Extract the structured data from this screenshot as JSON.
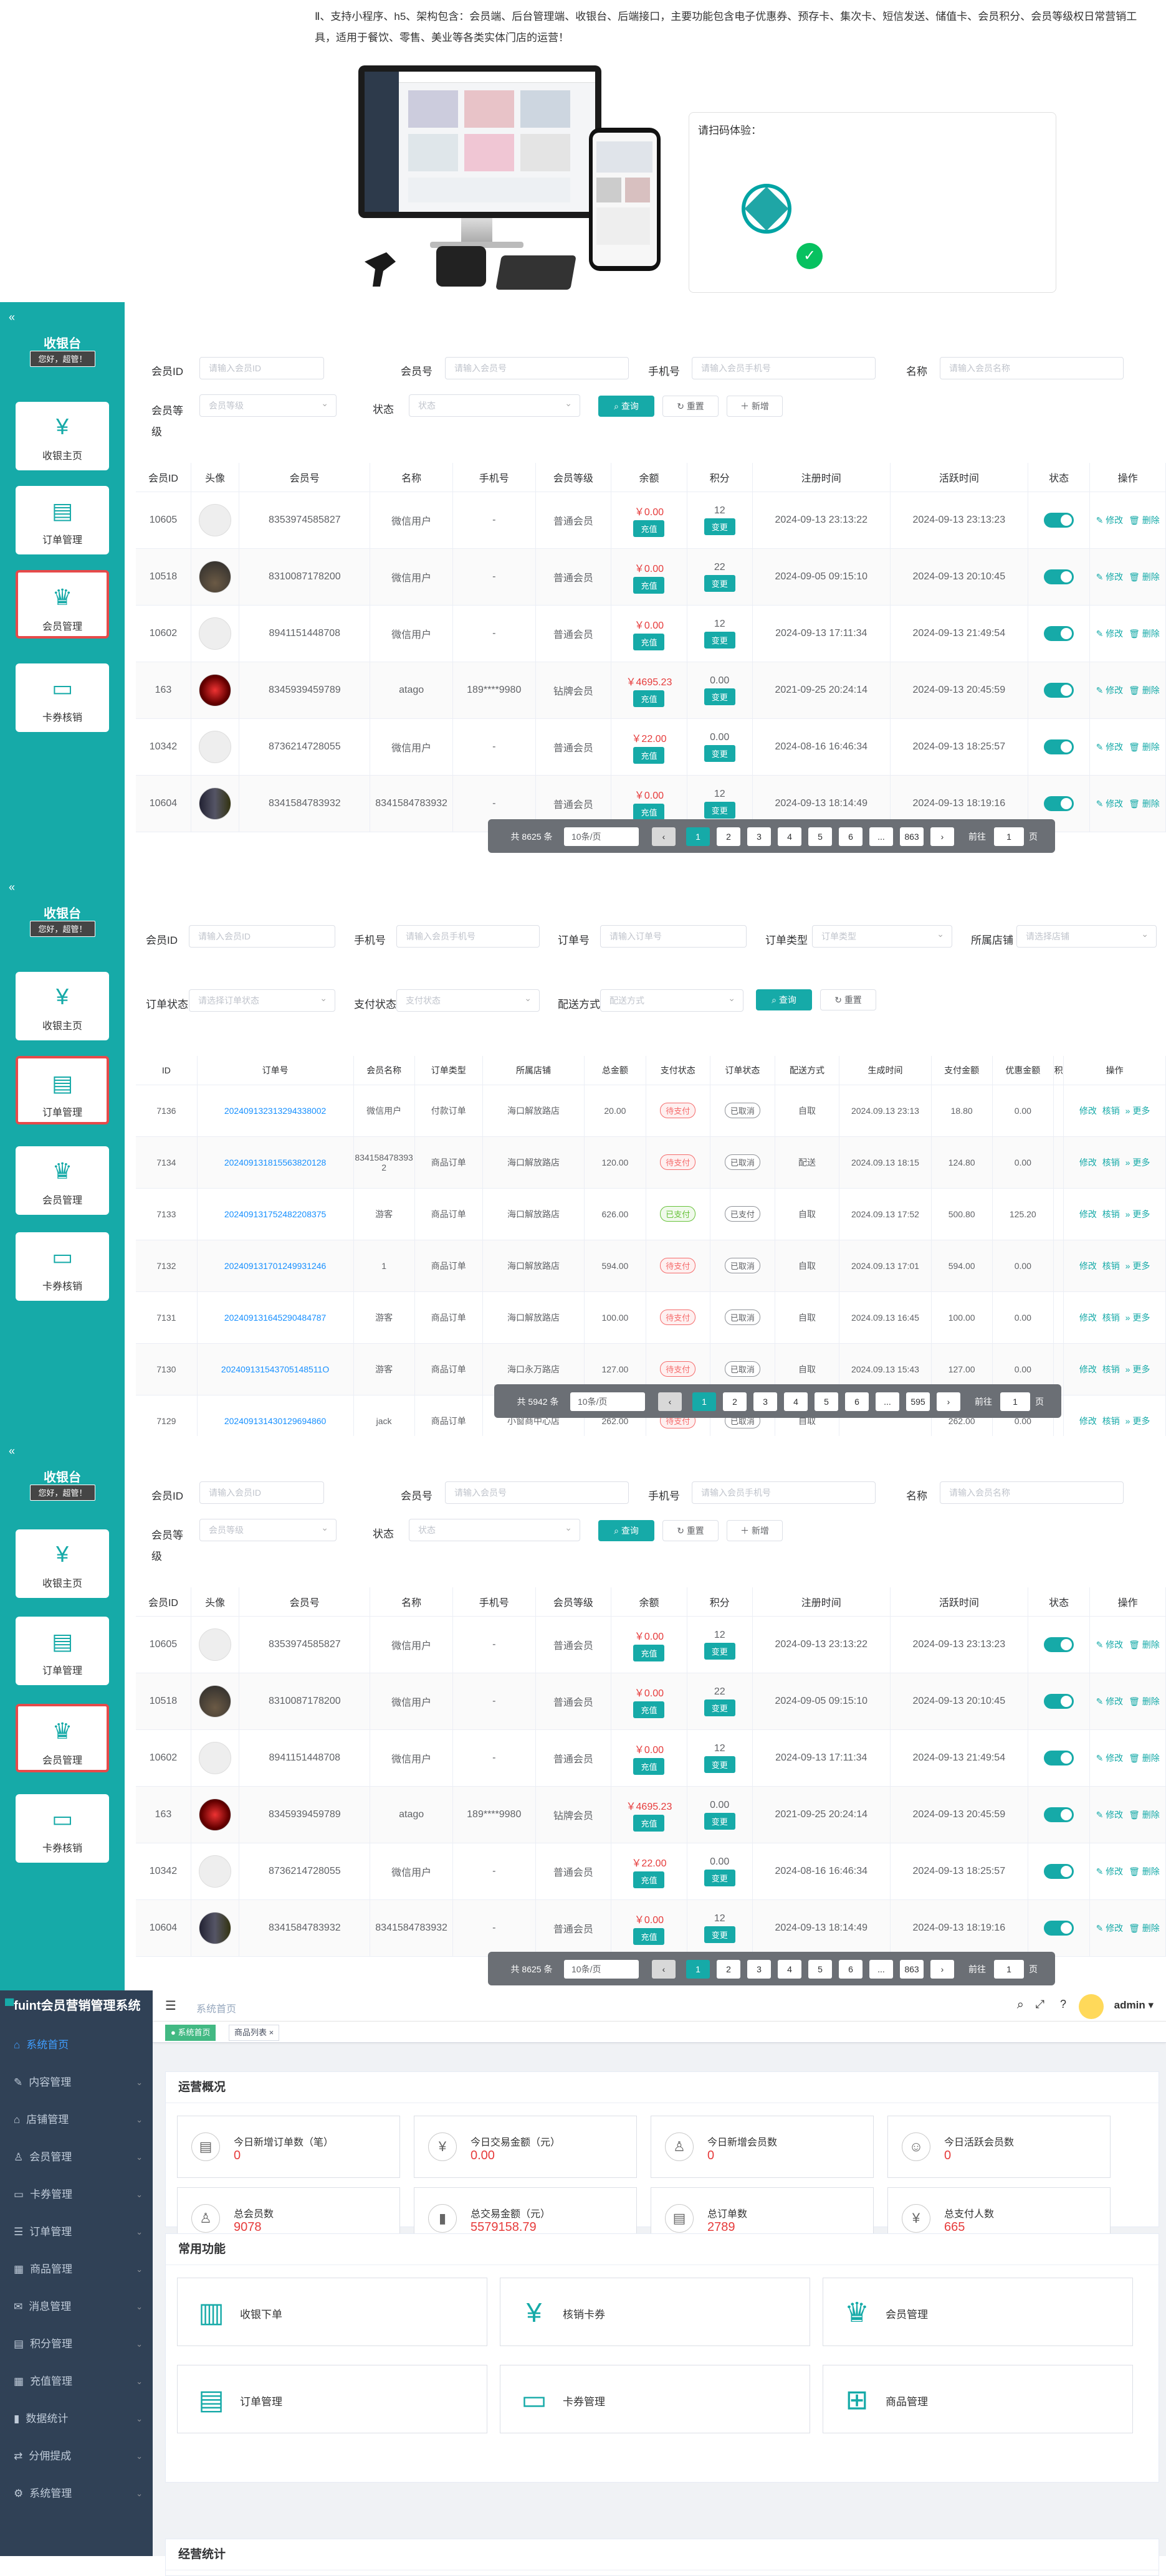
{
  "hero": {
    "text": "Ⅱ、支持小程序、h5、架构包含：会员端、后台管理端、收银台、后端接口，主要功能包含电子优惠券、预存卡、集次卡、短信发送、储值卡、会员积分、会员等级权日常营销工具，适用于餐饮、零售、美业等各类实体门店的运营！",
    "qr_label": "请扫码体验："
  },
  "cashier": {
    "title": "收银台",
    "greet": "您好，超管！",
    "nav": [
      "收银主页",
      "订单管理",
      "会员管理",
      "卡券核销"
    ]
  },
  "member_panel": {
    "filters": {
      "id_label": "会员ID",
      "id_ph": "请输入会员ID",
      "no_label": "会员号",
      "no_ph": "请输入会员号",
      "phone_label": "手机号",
      "phone_ph": "请输入会员手机号",
      "name_label": "名称",
      "name_ph": "请输入会员名称",
      "grade_label": "会员等级",
      "grade_ph": "会员等级",
      "status_label": "状态",
      "status_ph": "状态",
      "query": "查询",
      "reset": "重置",
      "add": "新增"
    },
    "columns": [
      "会员ID",
      "头像",
      "会员号",
      "名称",
      "手机号",
      "会员等级",
      "余额",
      "积分",
      "注册时间",
      "活跃时间",
      "状态",
      "操作"
    ],
    "rows": [
      {
        "id": "10605",
        "no": "8353974585827",
        "name": "微信用户",
        "phone": "-",
        "grade": "普通会员",
        "bal": "￥0.00",
        "pts": "12",
        "reg": "2024-09-13 23:13:22",
        "act": "2024-09-13 23:13:23",
        "av": "blank"
      },
      {
        "id": "10518",
        "no": "8310087178200",
        "name": "微信用户",
        "phone": "-",
        "grade": "普通会员",
        "bal": "￥0.00",
        "pts": "22",
        "reg": "2024-09-05 09:15:10",
        "act": "2024-09-13 20:10:45",
        "av": "a1"
      },
      {
        "id": "10602",
        "no": "8941151448708",
        "name": "微信用户",
        "phone": "-",
        "grade": "普通会员",
        "bal": "￥0.00",
        "pts": "12",
        "reg": "2024-09-13 17:11:34",
        "act": "2024-09-13 21:49:54",
        "av": "blank"
      },
      {
        "id": "163",
        "no": "8345939459789",
        "name": "atago",
        "phone": "189****9980",
        "grade": "钻牌会员",
        "bal": "￥4695.23",
        "pts": "0.00",
        "reg": "2021-09-25 20:24:14",
        "act": "2024-09-13 20:45:59",
        "av": "a2"
      },
      {
        "id": "10342",
        "no": "8736214728055",
        "name": "微信用户",
        "phone": "-",
        "grade": "普通会员",
        "bal": "￥22.00",
        "pts": "0.00",
        "reg": "2024-08-16 16:46:34",
        "act": "2024-09-13 18:25:57",
        "av": "blank"
      },
      {
        "id": "10604",
        "no": "8341584783932",
        "name": "8341584783932",
        "phone": "-",
        "grade": "普通会员",
        "bal": "￥0.00",
        "pts": "12",
        "reg": "2024-09-13 18:14:49",
        "act": "2024-09-13 18:19:16",
        "av": "a3"
      }
    ],
    "charge": "充值",
    "change": "变更",
    "edit": "修改",
    "del": "删除",
    "pager": {
      "total": "共 8625 条",
      "size": "10条/页",
      "pages": [
        "1",
        "2",
        "3",
        "4",
        "5",
        "6",
        "...",
        "863"
      ],
      "goto": "前往",
      "page": "1",
      "unit": "页"
    }
  },
  "order_panel": {
    "filters": {
      "mid_label": "会员ID",
      "mid_ph": "请输入会员ID",
      "phone_label": "手机号",
      "phone_ph": "请输入会员手机号",
      "ono_label": "订单号",
      "ono_ph": "请输入订单号",
      "otype_label": "订单类型",
      "otype_ph": "订单类型",
      "store_label": "所属店铺",
      "store_ph": "请选择店铺",
      "ostat_label": "订单状态",
      "ostat_ph": "请选择订单状态",
      "pay_label": "支付状态",
      "pay_ph": "支付状态",
      "del_label": "配送方式",
      "del_ph": "配送方式",
      "query": "查询",
      "reset": "重置"
    },
    "columns": [
      "ID",
      "订单号",
      "会员名称",
      "订单类型",
      "所属店铺",
      "总金额",
      "支付状态",
      "订单状态",
      "配送方式",
      "生成时间",
      "支付金额",
      "优惠金额",
      "积",
      "操作"
    ],
    "rows": [
      {
        "id": "7136",
        "no": "202409132313294338002",
        "mem": "微信用户",
        "type": "付款订单",
        "store": "海口解放路店",
        "amt": "20.00",
        "pay": "待支付",
        "ps": "w",
        "st": "已取消",
        "del": "自取",
        "time": "2024.09.13 23:13",
        "pamt": "18.80",
        "disc": "0.00"
      },
      {
        "id": "7134",
        "no": "202409131815563820128",
        "mem": "8341584783932",
        "type": "商品订单",
        "store": "海口解放路店",
        "amt": "120.00",
        "pay": "待支付",
        "ps": "w",
        "st": "已取消",
        "del": "配送",
        "time": "2024.09.13 18:15",
        "pamt": "124.80",
        "disc": "0.00"
      },
      {
        "id": "7133",
        "no": "202409131752482208375",
        "mem": "游客",
        "type": "商品订单",
        "store": "海口解放路店",
        "amt": "626.00",
        "pay": "已支付",
        "ps": "g",
        "st": "已支付",
        "del": "自取",
        "time": "2024.09.13 17:52",
        "pamt": "500.80",
        "disc": "125.20"
      },
      {
        "id": "7132",
        "no": "202409131701249931246",
        "mem": "1",
        "type": "商品订单",
        "store": "海口解放路店",
        "amt": "594.00",
        "pay": "待支付",
        "ps": "w",
        "st": "已取消",
        "del": "自取",
        "time": "2024.09.13 17:01",
        "pamt": "594.00",
        "disc": "0.00"
      },
      {
        "id": "7131",
        "no": "202409131645290484787",
        "mem": "游客",
        "type": "商品订单",
        "store": "海口解放路店",
        "amt": "100.00",
        "pay": "待支付",
        "ps": "w",
        "st": "已取消",
        "del": "自取",
        "time": "2024.09.13 16:45",
        "pamt": "100.00",
        "disc": "0.00"
      },
      {
        "id": "7130",
        "no": "202409131543705148511O",
        "mem": "游客",
        "type": "商品订单",
        "store": "海口永万路店",
        "amt": "127.00",
        "pay": "待支付",
        "ps": "w",
        "st": "已取消",
        "del": "自取",
        "time": "2024.09.13 15:43",
        "pamt": "127.00",
        "disc": "0.00"
      },
      {
        "id": "7129",
        "no": "202409131430129694860",
        "mem": "jack",
        "type": "商品订单",
        "store": "小窗商中心店",
        "amt": "262.00",
        "pay": "待支付",
        "ps": "w",
        "st": "已取消",
        "del": "自取",
        "time": "",
        "pamt": "262.00",
        "disc": "0.00"
      }
    ],
    "ops": [
      "修改",
      "核销",
      "更多"
    ],
    "pager": {
      "total": "共 5942 条",
      "size": "10条/页",
      "pages": [
        "1",
        "2",
        "3",
        "4",
        "5",
        "6",
        "...",
        "595"
      ],
      "goto": "前往",
      "page": "1",
      "unit": "页"
    }
  },
  "admin": {
    "brand": "fuint会员营销管理系统",
    "menu": [
      "系统首页",
      "内容管理",
      "店铺管理",
      "会员管理",
      "卡券管理",
      "订单管理",
      "商品管理",
      "消息管理",
      "积分管理",
      "充值管理",
      "数据统计",
      "分佣提成",
      "系统管理"
    ],
    "breadcrumb": "系统首页",
    "user": "admin",
    "tabs": [
      "系统首页",
      "商品列表"
    ],
    "overview_title": "运营概况",
    "stats": [
      {
        "label": "今日新增订单数（笔）",
        "value": "0",
        "icon": "order-icon"
      },
      {
        "label": "今日交易金额（元）",
        "value": "0.00",
        "icon": "money-icon"
      },
      {
        "label": "今日新增会员数",
        "value": "0",
        "icon": "user-add-icon"
      },
      {
        "label": "今日活跃会员数",
        "value": "0",
        "icon": "active-user-icon"
      },
      {
        "label": "总会员数",
        "value": "9078",
        "icon": "users-icon"
      },
      {
        "label": "总交易金额（元）",
        "value": "5579158.79",
        "icon": "bar-chart-icon"
      },
      {
        "label": "总订单数",
        "value": "2789",
        "icon": "document-icon"
      },
      {
        "label": "总支付人数",
        "value": "665",
        "icon": "payer-icon"
      }
    ],
    "quick_title": "常用功能",
    "quick": [
      {
        "label": "收银下单",
        "icon": "barcode-icon"
      },
      {
        "label": "核销卡券",
        "icon": "coupon-verify-icon"
      },
      {
        "label": "会员管理",
        "icon": "crown-icon"
      },
      {
        "label": "订单管理",
        "icon": "orders-icon"
      },
      {
        "label": "卡券管理",
        "icon": "ticket-icon"
      },
      {
        "label": "商品管理",
        "icon": "goods-icon"
      }
    ],
    "bottom_title": "经营统计"
  }
}
